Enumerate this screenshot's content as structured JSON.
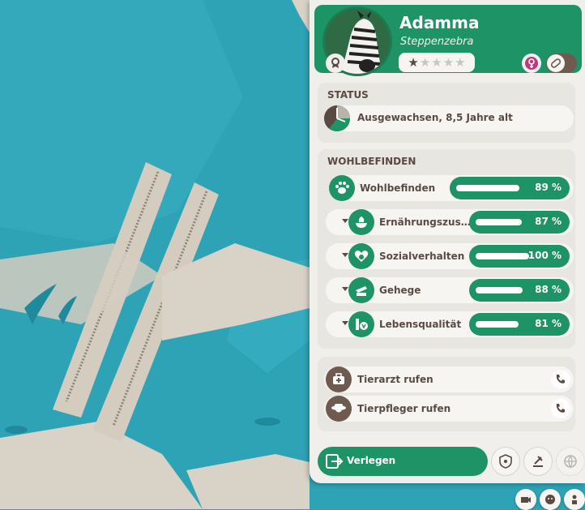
{
  "animal": {
    "name": "Adamma",
    "species": "Steppenzebra",
    "stars_filled": 1,
    "stars_total": 5
  },
  "status": {
    "title": "STATUS",
    "text": "Ausgewachsen, 8,5 Jahre alt"
  },
  "wellbeing": {
    "title": "WOHLBEFINDEN",
    "main": {
      "label": "Wohlbefinden",
      "value": "89 %",
      "fraction": 0.89,
      "icon": "paw-icon"
    },
    "items": [
      {
        "label": "Ernährungszus…",
        "value": "87 %",
        "fraction": 0.87,
        "icon": "food-icon"
      },
      {
        "label": "Sozialverhalten",
        "value": "100 %",
        "fraction": 1.0,
        "icon": "social-icon"
      },
      {
        "label": "Gehege",
        "value": "88 %",
        "fraction": 0.88,
        "icon": "habitat-icon"
      },
      {
        "label": "Lebensqualität",
        "value": "81 %",
        "fraction": 0.81,
        "icon": "enrichment-icon"
      }
    ]
  },
  "actions": {
    "vet": "Tierarzt rufen",
    "keeper": "Tierpfleger rufen",
    "move": "Verlegen"
  },
  "colors": {
    "accent": "#1e9466",
    "brown": "#5a4a42",
    "panel": "#f1efeb",
    "water": "#2fa3b6"
  }
}
